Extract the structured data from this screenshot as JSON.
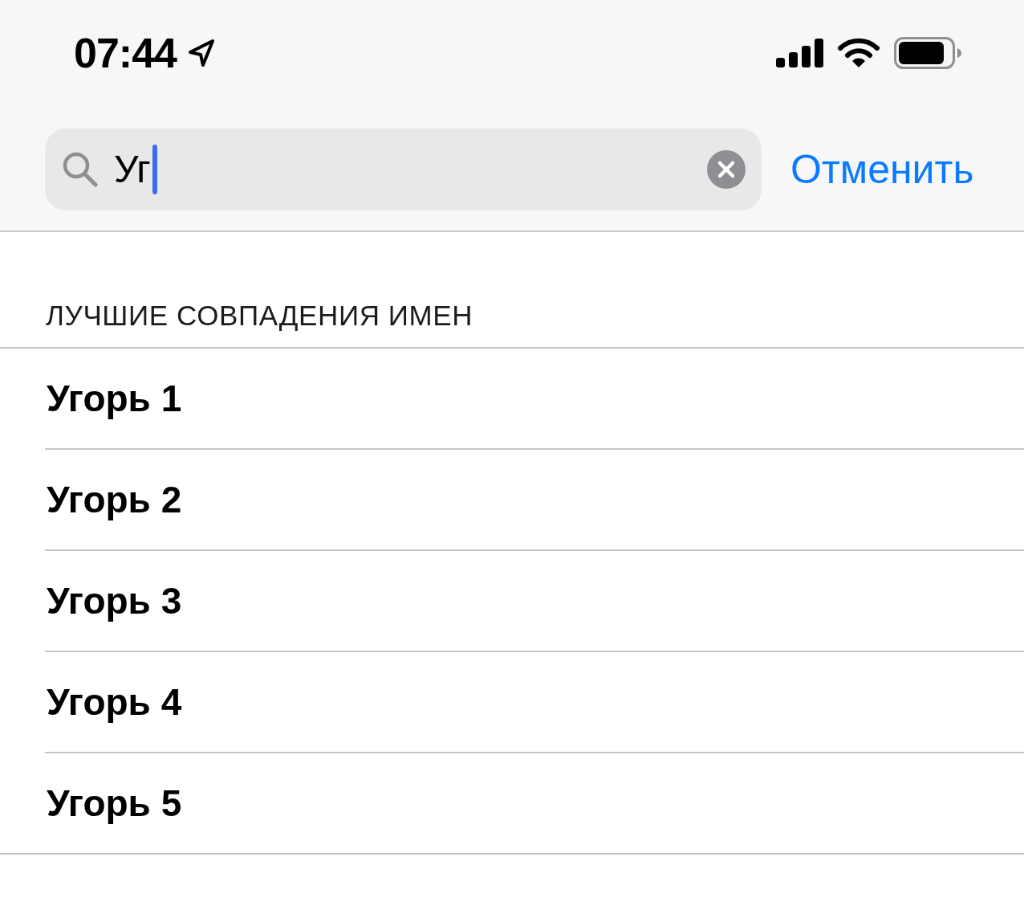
{
  "status_bar": {
    "time": "07:44"
  },
  "search": {
    "value": "Уг",
    "focused": true,
    "cancel": "Отменить"
  },
  "section": {
    "title": "ЛУЧШИЕ СОВПАДЕНИЯ ИМЕН"
  },
  "results": [
    {
      "label": "Угорь 1"
    },
    {
      "label": "Угорь 2"
    },
    {
      "label": "Угорь 3"
    },
    {
      "label": "Угорь 4"
    },
    {
      "label": "Угорь 5"
    }
  ]
}
